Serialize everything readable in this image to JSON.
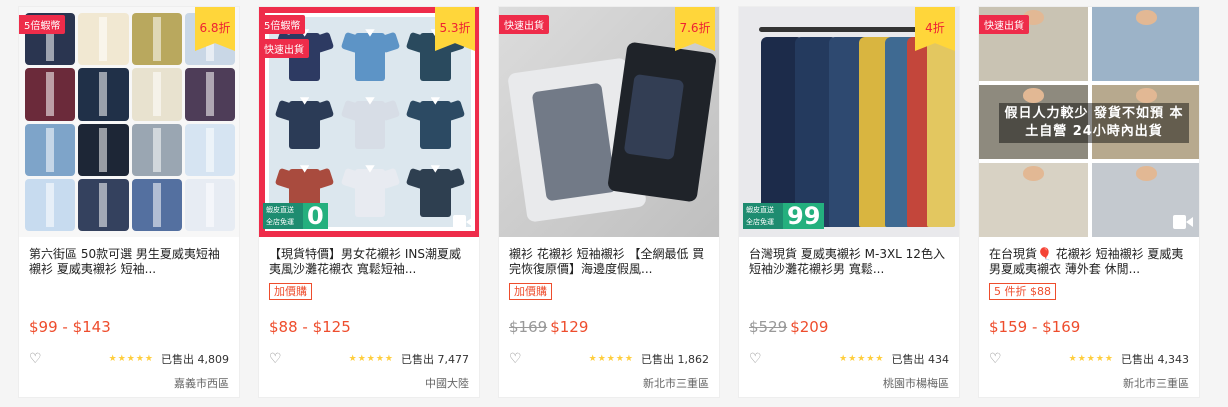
{
  "colors": {
    "accent": "#ee4d2d",
    "promo_red": "#ee2c4a",
    "discount_yellow": "#ffd63a",
    "ship_green": "#24b07e",
    "star": "#ffce3d"
  },
  "products": [
    {
      "title": "第六街區 50款可選 男生夏威夷短袖襯衫 夏威夷襯衫 短袖...",
      "badges": [
        "5倍蝦幣"
      ],
      "discount": "6.8折",
      "tag": "",
      "orig_price": "",
      "price": "$99 - $143",
      "stars": "★★★★★",
      "sold": "已售出 4,809",
      "location": "嘉義市西區",
      "shipping_num": "",
      "has_video": false,
      "favorite_icon": "heart-outline-icon"
    },
    {
      "title": "【現貨特價】男女花襯衫 INS潮夏威夷風沙灘花襯衣 寬鬆短袖...",
      "badges": [
        "5倍蝦幣",
        "快速出貨"
      ],
      "discount": "5.3折",
      "tag": "加價購",
      "orig_price": "",
      "price": "$88 - $125",
      "stars": "★★★★★",
      "sold": "已售出 7,477",
      "location": "中國大陸",
      "shipping_label": "蝦皮直送 全店免運",
      "shipping_num": "0",
      "has_video": true,
      "favorite_icon": "heart-outline-icon"
    },
    {
      "title": "襯衫 花襯衫 短袖襯衫 【全網最低 買完恢復原價】海邊度假風...",
      "badges": [
        "快速出貨"
      ],
      "discount": "7.6折",
      "tag": "加價購",
      "orig_price": "$169",
      "price": "$129",
      "stars": "★★★★★",
      "sold": "已售出 1,862",
      "location": "新北市三重區",
      "shipping_num": "",
      "has_video": false,
      "favorite_icon": "heart-outline-icon"
    },
    {
      "title": "台灣現貨 夏威夷襯衫 M-3XL 12色入 短袖沙灘花襯衫男 寬鬆...",
      "badges": [],
      "discount": "4折",
      "tag": "",
      "orig_price": "$529",
      "price": "$209",
      "stars": "★★★★★",
      "sold": "已售出 434",
      "location": "桃園市楊梅區",
      "shipping_label": "蝦皮直送 全店免運",
      "shipping_num": "99",
      "has_video": false,
      "favorite_icon": "heart-outline-icon"
    },
    {
      "title": "在台現貨🎈 花襯衫 短袖襯衫 夏威夷男夏威夷襯衣 薄外套 休閒...",
      "badges": [
        "快速出貨"
      ],
      "discount": "",
      "tag": "5 件折 $88",
      "orig_price": "",
      "price": "$159 - $169",
      "stars": "★★★★★",
      "sold": "已售出 4,343",
      "location": "新北市三重區",
      "overlay": "假日人力較少 發貨不如預 本土自營 24小時內出貨",
      "shipping_num": "",
      "has_video": true,
      "favorite_icon": "heart-outline-icon"
    }
  ]
}
